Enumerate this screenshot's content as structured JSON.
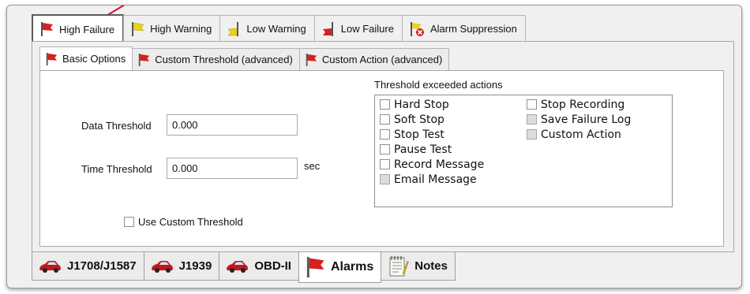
{
  "alarm_tabs": [
    {
      "label": "High Failure",
      "icon": "red-flag-icon"
    },
    {
      "label": "High Warning",
      "icon": "yellow-flag-icon"
    },
    {
      "label": "Low Warning",
      "icon": "yellow-flag-low-icon"
    },
    {
      "label": "Low Failure",
      "icon": "red-flag-low-icon"
    },
    {
      "label": "Alarm Suppression",
      "icon": "alarm-suppression-icon"
    }
  ],
  "option_tabs": [
    {
      "label": "Basic Options",
      "icon": "red-flag-icon"
    },
    {
      "label": "Custom Threshold (advanced)",
      "icon": "red-flag-icon"
    },
    {
      "label": "Custom Action (advanced)",
      "icon": "red-flag-icon"
    }
  ],
  "form": {
    "data_threshold_label": "Data Threshold",
    "data_threshold_value": "0.000",
    "time_threshold_label": "Time Threshold",
    "time_threshold_value": "0.000",
    "time_unit": "sec",
    "use_custom_threshold_label": "Use Custom Threshold"
  },
  "actions": {
    "title": "Threshold exceeded actions",
    "left": [
      "Hard Stop",
      "Soft Stop",
      "Stop Test",
      "Pause Test",
      "Record Message",
      "Email Message"
    ],
    "right": [
      "Stop Recording",
      "Save Failure Log",
      "Custom Action"
    ]
  },
  "bottom_tabs": [
    {
      "label": "J1708/J1587",
      "icon": "car-icon"
    },
    {
      "label": "J1939",
      "icon": "car-icon"
    },
    {
      "label": "OBD-II",
      "icon": "car-icon"
    },
    {
      "label": "Alarms",
      "icon": "red-flag-icon"
    },
    {
      "label": "Notes",
      "icon": "notepad-icon"
    }
  ],
  "colors": {
    "flag_red": "#d42020",
    "flag_yellow": "#e8d21a",
    "pointer": "#c8102e"
  }
}
